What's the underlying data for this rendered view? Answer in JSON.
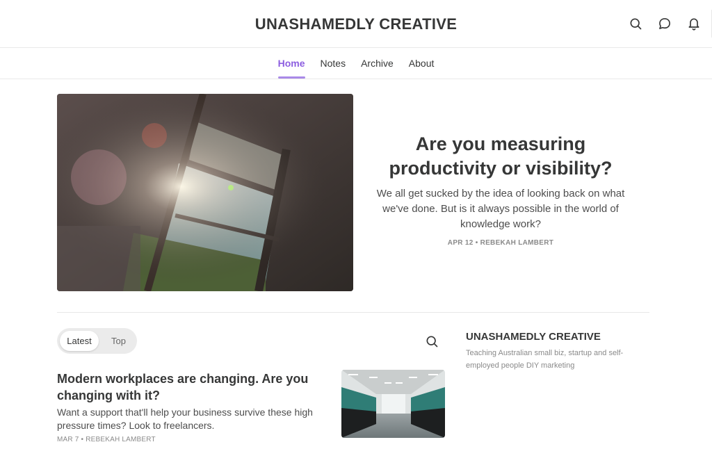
{
  "header": {
    "site_title": "UNASHAMEDLY CREATIVE",
    "icons": [
      "search-icon",
      "chat-icon",
      "bell-icon"
    ]
  },
  "nav": {
    "items": [
      {
        "label": "Home",
        "active": true
      },
      {
        "label": "Notes",
        "active": false
      },
      {
        "label": "Archive",
        "active": false
      },
      {
        "label": "About",
        "active": false
      }
    ]
  },
  "featured": {
    "title": "Are you measuring productivity or visibility?",
    "subtitle": "We all get sucked by the idea of looking back on what we've done. But is it always possible in the world of knowledge work?",
    "meta": "APR 12 • REBEKAH LAMBERT",
    "image_alt": "Window with sunlight flare"
  },
  "feed": {
    "tabs": [
      {
        "label": "Latest",
        "active": true
      },
      {
        "label": "Top",
        "active": false
      }
    ],
    "posts": [
      {
        "title": "Modern workplaces are changing. Are you changing with it?",
        "subtitle": "Want a support that'll help your business survive these high pressure times? Look to freelancers.",
        "meta": "MAR 7 • REBEKAH LAMBERT",
        "image_alt": "Empty office with rows of cubicles"
      }
    ]
  },
  "sidebar": {
    "title": "UNASHAMEDLY CREATIVE",
    "description": "Teaching Australian small biz, startup and self-employed people DIY marketing"
  },
  "colors": {
    "accent": "#8c5ee0",
    "text": "#363737",
    "muted": "#8a8a8a"
  }
}
